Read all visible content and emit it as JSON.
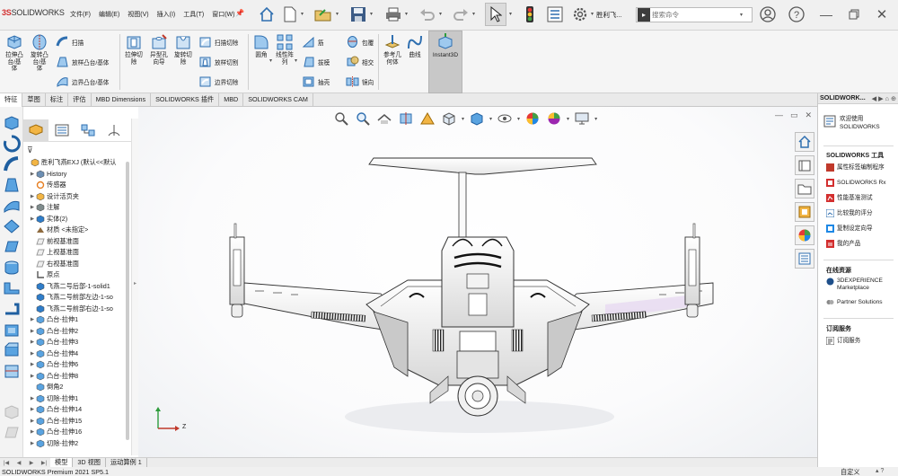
{
  "app": {
    "logo_mark": "3S",
    "logo_text": "SOLIDWORKS",
    "menus": [
      "文件(F)",
      "编辑(E)",
      "视图(V)",
      "插入(I)",
      "工具(T)",
      "窗口(W)"
    ],
    "document_name": "胜利飞...",
    "search_placeholder": "搜索命令"
  },
  "ribbon": {
    "big_buttons": [
      {
        "label": "拉伸凸\n台/基\n体",
        "icon": "extrude-boss-icon"
      },
      {
        "label": "旋转凸\n台/基\n体",
        "icon": "revolve-boss-icon"
      },
      {
        "label": "拉伸切\n除",
        "icon": "extrude-cut-icon"
      },
      {
        "label": "异型孔\n向导",
        "icon": "hole-wizard-icon"
      },
      {
        "label": "旋转切\n除",
        "icon": "revolve-cut-icon"
      },
      {
        "label": "圆角",
        "icon": "fillet-icon"
      },
      {
        "label": "线性阵\n列",
        "icon": "linear-pattern-icon"
      },
      {
        "label": "参考几\n何体",
        "icon": "reference-geometry-icon"
      },
      {
        "label": "曲线",
        "icon": "curves-icon"
      },
      {
        "label": "Instant3D",
        "icon": "instant3d-icon"
      }
    ],
    "small_buttons": {
      "sweep": "扫描",
      "loft": "放样凸台/基体",
      "boundary": "边界凸台/基体",
      "swept_cut": "扫描切除",
      "lofted_cut": "放样切割",
      "boundary_cut": "边界切除",
      "rib": "筋",
      "draft": "拔模",
      "shell": "抽壳",
      "wrap": "包覆",
      "intersect": "相交",
      "mirror": "镜向"
    }
  },
  "tabs": [
    "特征",
    "草图",
    "标注",
    "评估",
    "MBD Dimensions",
    "SOLIDWORKS 插件",
    "MBD",
    "SOLIDWORKS CAM"
  ],
  "tree": {
    "items": [
      {
        "label": "胜利飞燕EXJ  (默认<<默认",
        "expander": "",
        "icon": "part-icon",
        "indent": 0
      },
      {
        "label": "History",
        "expander": "▶",
        "icon": "history-icon",
        "indent": 1
      },
      {
        "label": "传感器",
        "expander": "",
        "icon": "sensor-icon",
        "indent": 1
      },
      {
        "label": "设计活页夹",
        "expander": "▶",
        "icon": "design-binder-icon",
        "indent": 1
      },
      {
        "label": "注解",
        "expander": "▶",
        "icon": "annotations-icon",
        "indent": 1
      },
      {
        "label": "实体(2)",
        "expander": "▶",
        "icon": "solid-bodies-icon",
        "indent": 1
      },
      {
        "label": "材质 <未指定>",
        "expander": "",
        "icon": "material-icon",
        "indent": 1
      },
      {
        "label": "前视基准面",
        "expander": "",
        "icon": "plane-icon",
        "indent": 1
      },
      {
        "label": "上视基准面",
        "expander": "",
        "icon": "plane-icon",
        "indent": 1
      },
      {
        "label": "右视基准面",
        "expander": "",
        "icon": "plane-icon",
        "indent": 1
      },
      {
        "label": "原点",
        "expander": "",
        "icon": "origin-icon",
        "indent": 1
      },
      {
        "label": "飞燕二号后部-1-solid1",
        "expander": "",
        "icon": "imported-body-icon",
        "indent": 1
      },
      {
        "label": "飞燕二号前部左边-1-so",
        "expander": "",
        "icon": "imported-body-icon",
        "indent": 1
      },
      {
        "label": "飞燕二号前部右边-1-so",
        "expander": "",
        "icon": "imported-body-icon",
        "indent": 1
      },
      {
        "label": "凸台-拉伸1",
        "expander": "▶",
        "icon": "boss-extrude-icon",
        "indent": 1
      },
      {
        "label": "凸台-拉伸2",
        "expander": "▶",
        "icon": "boss-extrude-icon",
        "indent": 1
      },
      {
        "label": "凸台-拉伸3",
        "expander": "▶",
        "icon": "boss-extrude-icon",
        "indent": 1
      },
      {
        "label": "凸台-拉伸4",
        "expander": "▶",
        "icon": "boss-extrude-icon",
        "indent": 1
      },
      {
        "label": "凸台-拉伸6",
        "expander": "▶",
        "icon": "boss-extrude-icon",
        "indent": 1
      },
      {
        "label": "凸台-拉伸8",
        "expander": "▶",
        "icon": "boss-extrude-icon",
        "indent": 1
      },
      {
        "label": "倒角2",
        "expander": "",
        "icon": "chamfer-icon",
        "indent": 1
      },
      {
        "label": "切除-拉伸1",
        "expander": "▶",
        "icon": "cut-extrude-icon",
        "indent": 1
      },
      {
        "label": "凸台-拉伸14",
        "expander": "▶",
        "icon": "boss-extrude-icon",
        "indent": 1
      },
      {
        "label": "凸台-拉伸15",
        "expander": "▶",
        "icon": "boss-extrude-icon",
        "indent": 1
      },
      {
        "label": "凸台-拉伸16",
        "expander": "▶",
        "icon": "boss-extrude-icon",
        "indent": 1
      },
      {
        "label": "切除-拉伸2",
        "expander": "▶",
        "icon": "cut-extrude-icon",
        "indent": 1
      }
    ]
  },
  "bottom_tabs": [
    "模型",
    "3D 视图",
    "运动算例 1"
  ],
  "status": {
    "version": "SOLIDWORKS Premium 2021 SP5.1",
    "customize": "自定义"
  },
  "triad": {
    "x": "X",
    "y": "Y",
    "z": "Z"
  },
  "task_pane": {
    "header": "SOLIDWORK...",
    "welcome": "欢迎使用\nSOLIDWORKS",
    "tools_title": "SOLIDWORKS 工具",
    "tools": [
      "属性标签编制程序",
      "SOLIDWORKS Rx",
      "性能基准测试",
      "比较我的评分",
      "复制设定向导",
      "我的产品"
    ],
    "online_title": "在线资源",
    "online": [
      "3DEXPERIENCE\nMarketplace",
      "Partner Solutions"
    ],
    "subscription_title": "订阅服务",
    "subscription": [
      "订阅服务"
    ]
  },
  "colors": {
    "solidworks_red": "#d32f2f",
    "accent_blue": "#2f7dc9",
    "instant3d_bg": "#c8c8c8",
    "viewport_bg": "#f7f8fa"
  }
}
